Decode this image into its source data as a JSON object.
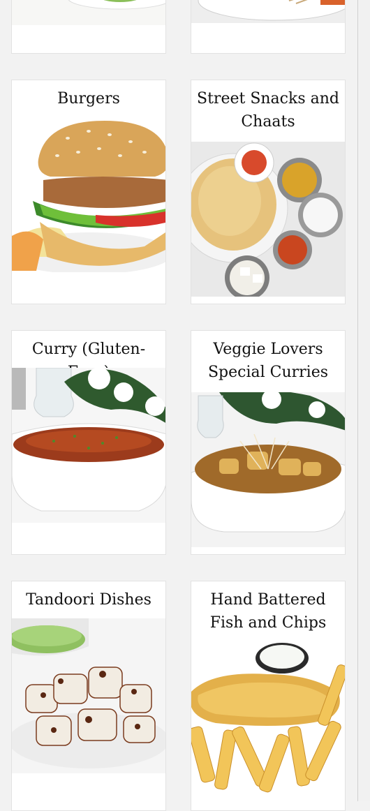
{
  "categories": [
    {
      "title": ""
    },
    {
      "title": ""
    },
    {
      "title": "Burgers"
    },
    {
      "title": "Street Snacks and Chaats"
    },
    {
      "title": "Curry (Gluten-Free)"
    },
    {
      "title": "Veggie Lovers Special Curries"
    },
    {
      "title": "Tandoori Dishes"
    },
    {
      "title": "Hand Battered Fish and Chips"
    }
  ]
}
